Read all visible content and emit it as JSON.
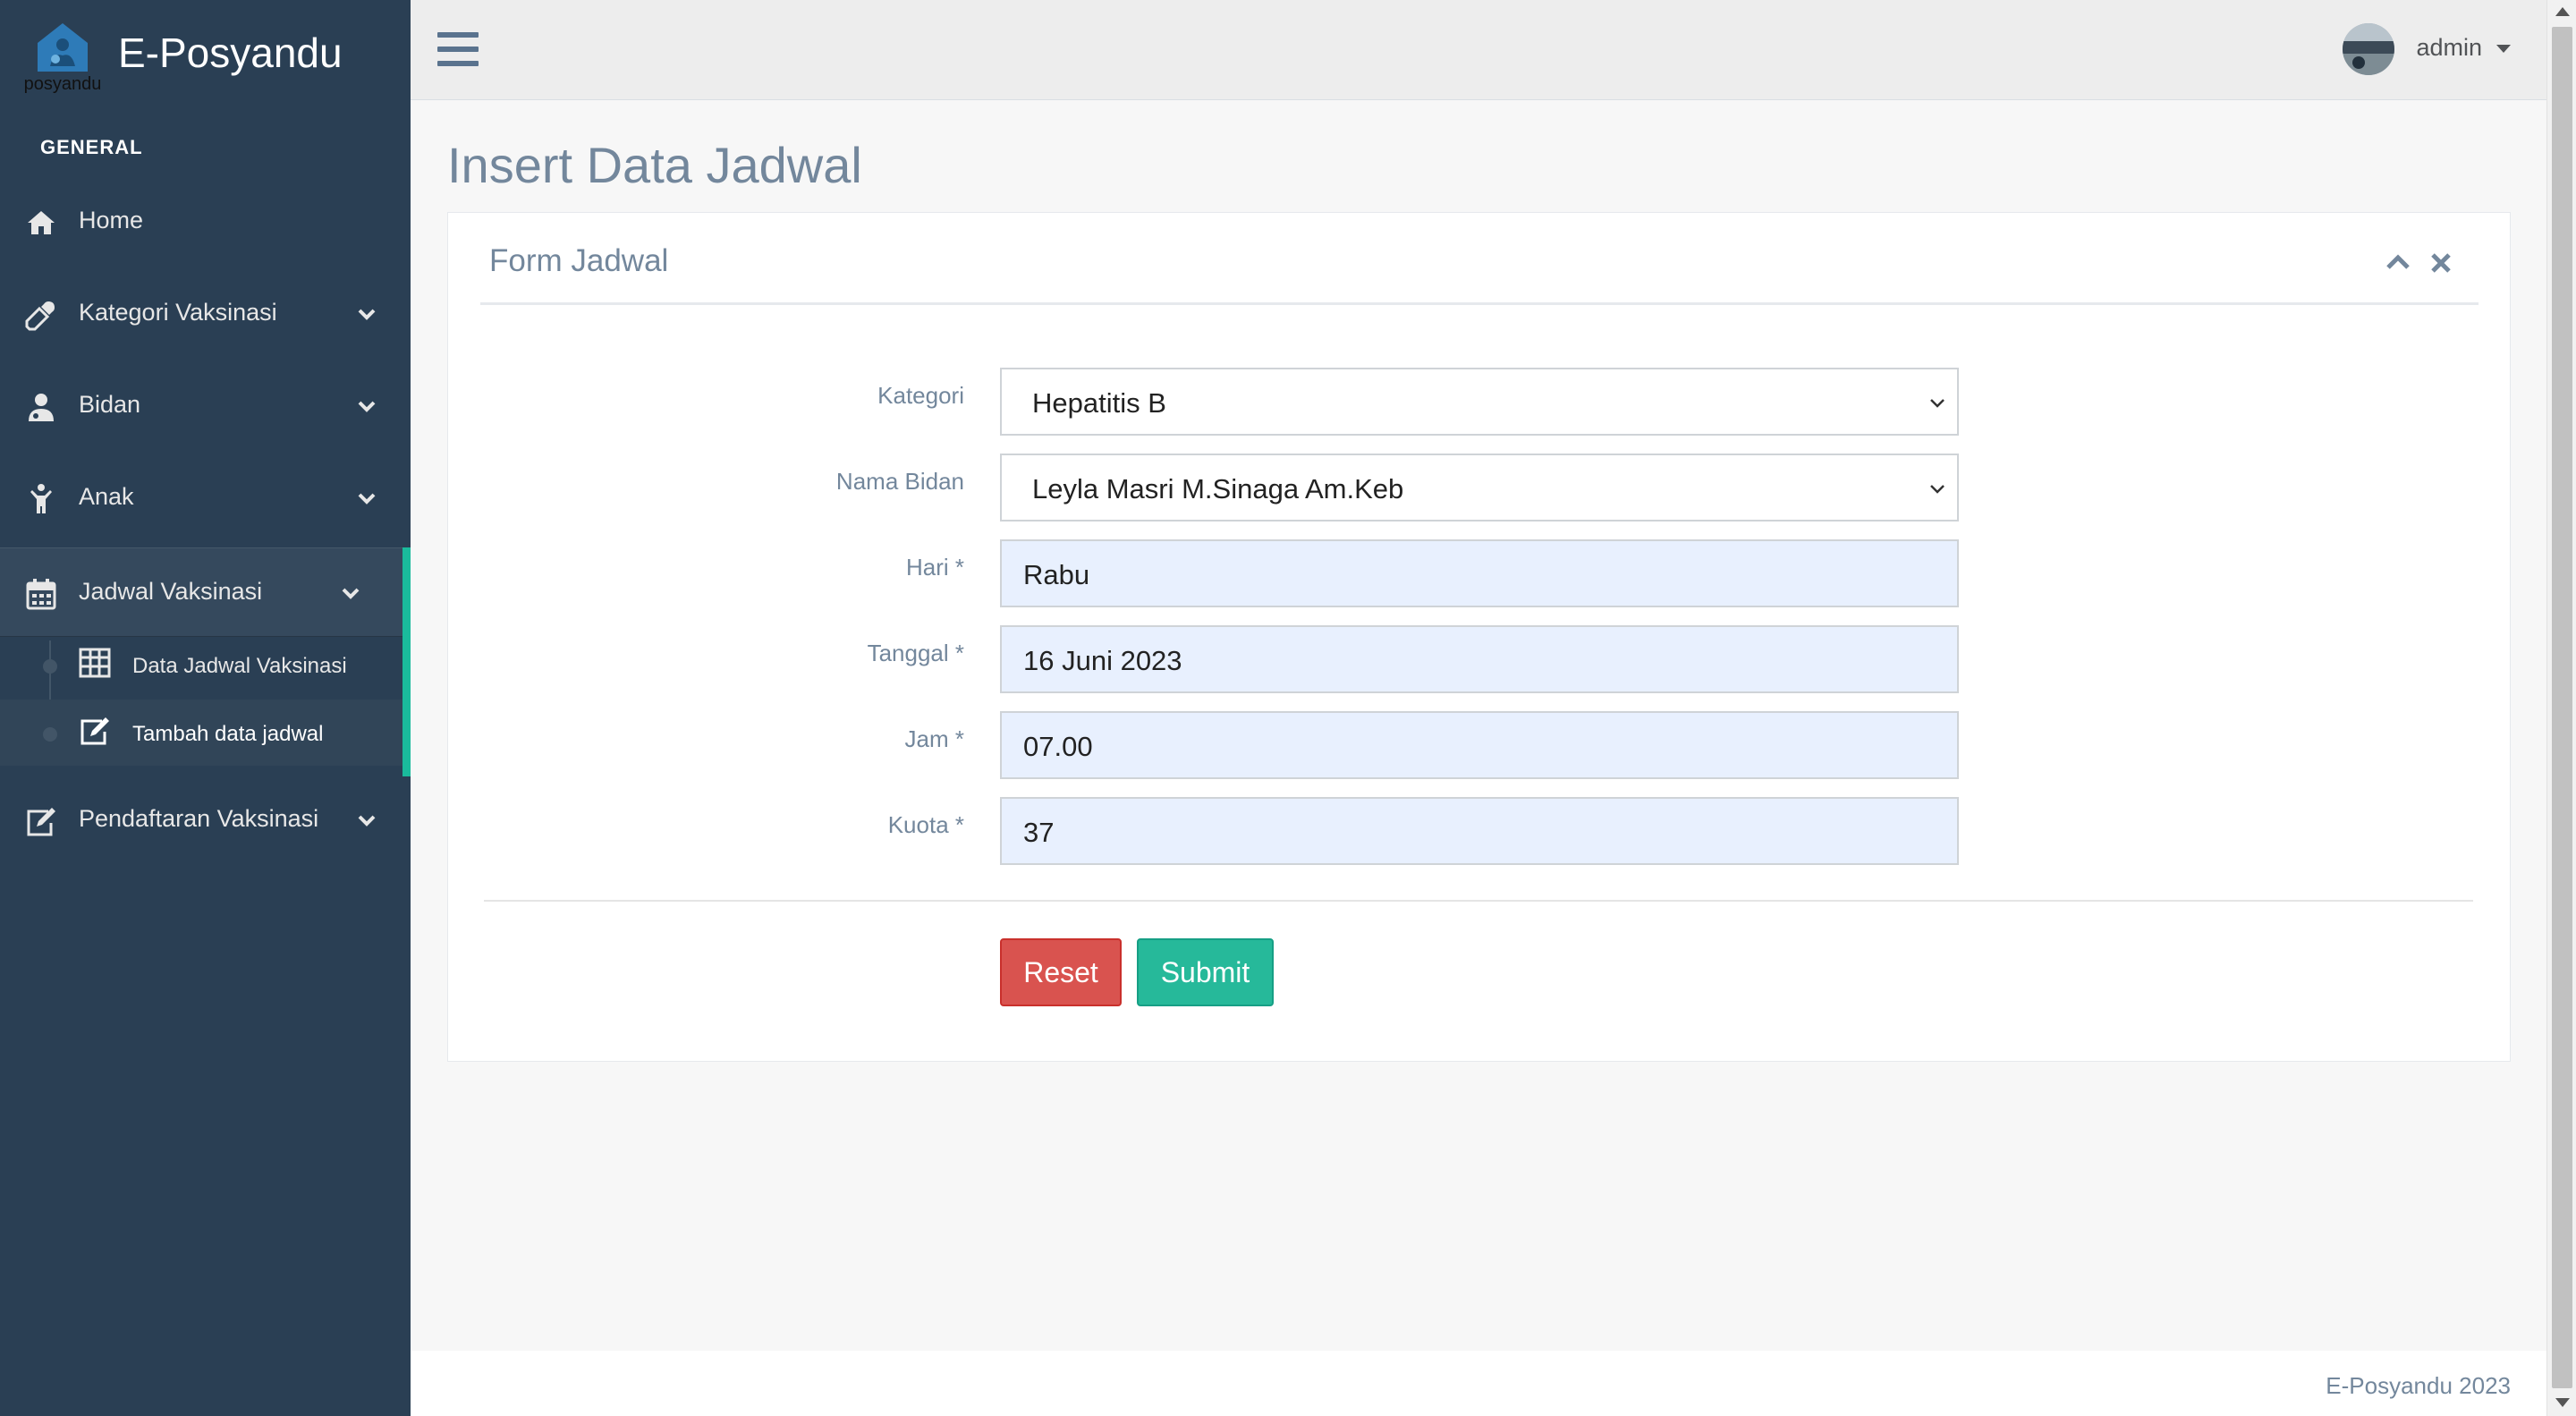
{
  "brand": {
    "logo_text": "posyandu",
    "title": "E-Posyandu"
  },
  "sidebar": {
    "section_title": "GENERAL",
    "items": [
      {
        "label": "Home",
        "icon": "home-icon"
      },
      {
        "label": "Kategori Vaksinasi",
        "icon": "eyedropper-icon"
      },
      {
        "label": "Bidan",
        "icon": "user-md-icon"
      },
      {
        "label": "Anak",
        "icon": "child-icon"
      },
      {
        "label": "Jadwal Vaksinasi",
        "icon": "calendar-icon"
      },
      {
        "label": "Pendaftaran Vaksinasi",
        "icon": "edit-icon"
      }
    ],
    "submenu": [
      {
        "label": "Data Jadwal Vaksinasi",
        "icon": "table-icon"
      },
      {
        "label": "Tambah data jadwal",
        "icon": "edit-icon"
      }
    ]
  },
  "topnav": {
    "user_name": "admin"
  },
  "page": {
    "title": "Insert Data Jadwal"
  },
  "panel": {
    "title": "Form Jadwal"
  },
  "form": {
    "kategori": {
      "label": "Kategori",
      "value": "Hepatitis B"
    },
    "nama_bidan": {
      "label": "Nama Bidan",
      "value": "Leyla Masri M.Sinaga Am.Keb"
    },
    "hari": {
      "label": "Hari *",
      "value": "Rabu"
    },
    "tanggal": {
      "label": "Tanggal *",
      "value": "16 Juni 2023"
    },
    "jam": {
      "label": "Jam *",
      "value": "07.00"
    },
    "kuota": {
      "label": "Kuota *",
      "value": "37"
    },
    "reset_label": "Reset",
    "submit_label": "Submit"
  },
  "footer": {
    "text": "E-Posyandu 2023"
  },
  "colors": {
    "sidebar_bg": "#2a3f54",
    "accent": "#1abb9c",
    "reset": "#d9534f",
    "submit": "#26b99a",
    "autofill_bg": "#e8f0fe",
    "heading": "#73879c"
  }
}
